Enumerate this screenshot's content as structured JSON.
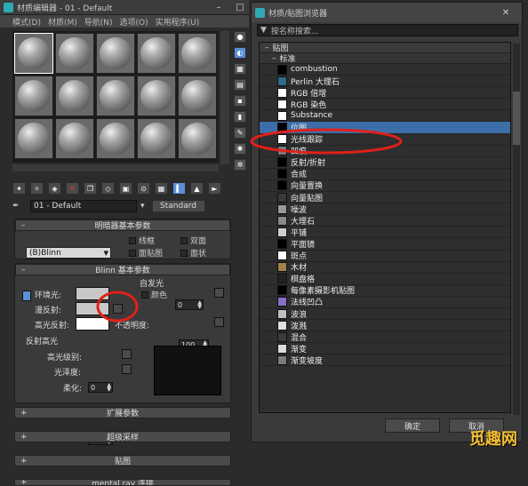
{
  "editor": {
    "title": "材质编辑器 - 01 - Default",
    "menu": [
      "模式(D)",
      "材质(M)",
      "导航(N)",
      "选项(O)",
      "实用程序(U)"
    ],
    "material_name": "01 - Default",
    "type_button": "Standard",
    "shader_rollout": {
      "title": "明暗器基本参数",
      "shader": "(B)Blinn",
      "checkboxes": [
        "线框",
        "双面",
        "面贴图",
        "面状"
      ]
    },
    "blinn_rollout": {
      "title": "Blinn 基本参数",
      "ambient_label": "环境光:",
      "diffuse_label": "漫反射:",
      "specular_label": "高光反射:",
      "self_illum_title": "自发光",
      "color_label": "颜色",
      "color_value": "0",
      "opacity_label": "不透明度:",
      "opacity_value": "100",
      "spec_highlights_title": "反射高光",
      "spec_level_label": "高光级别:",
      "spec_level_value": "0",
      "glossiness_label": "光泽度:",
      "glossiness_value": "10",
      "soften_label": "柔化:",
      "soften_value": "0.1"
    },
    "rollouts_collapsed": [
      "扩展参数",
      "超级采样",
      "贴图",
      "mental ray 连接"
    ]
  },
  "browser": {
    "title": "材质/贴图浏览器",
    "search_placeholder": "按名称搜索...",
    "category": "贴图",
    "subcategory": "标准",
    "items": [
      {
        "label": "combustion",
        "color": "#000000"
      },
      {
        "label": "Perlin 大理石",
        "color": "#2f6b8a"
      },
      {
        "label": "RGB 倍增",
        "color": "#ffffff"
      },
      {
        "label": "RGB 染色",
        "color": "#ffffff"
      },
      {
        "label": "Substance",
        "color": "#ffffff"
      },
      {
        "label": "位图",
        "color": "#000000",
        "selected": true
      },
      {
        "label": "光线跟踪",
        "color": "#ffffff"
      },
      {
        "label": "凹痕",
        "color": "#7a7a7a"
      },
      {
        "label": "反射/折射",
        "color": "#000000"
      },
      {
        "label": "合成",
        "color": "#000000"
      },
      {
        "label": "向量置换",
        "color": "#000000"
      },
      {
        "label": "向量贴图",
        "color": "#3a3a3a"
      },
      {
        "label": "噪波",
        "color": "#9a9a9a"
      },
      {
        "label": "大理石",
        "color": "#8a8a8a"
      },
      {
        "label": "平铺",
        "color": "#cfcfcf"
      },
      {
        "label": "平面镜",
        "color": "#000000"
      },
      {
        "label": "斑点",
        "color": "#ffffff"
      },
      {
        "label": "木材",
        "color": "#a0824a"
      },
      {
        "label": "棋盘格",
        "color": "#222222"
      },
      {
        "label": "每像素摄影机贴图",
        "color": "#000000"
      },
      {
        "label": "法线凹凸",
        "color": "#8a6fc8"
      },
      {
        "label": "波浪",
        "color": "#c0c0c0"
      },
      {
        "label": "泼溅",
        "color": "#e0e0e0"
      },
      {
        "label": "混合",
        "color": "#3a3a3a"
      },
      {
        "label": "渐变",
        "color": "#dcdcdc"
      },
      {
        "label": "渐变坡度",
        "color": "#7b7b7b"
      }
    ],
    "ok": "确定",
    "cancel": "取消"
  },
  "watermark": "觅趣网",
  "highlight_color": "#e0201a"
}
